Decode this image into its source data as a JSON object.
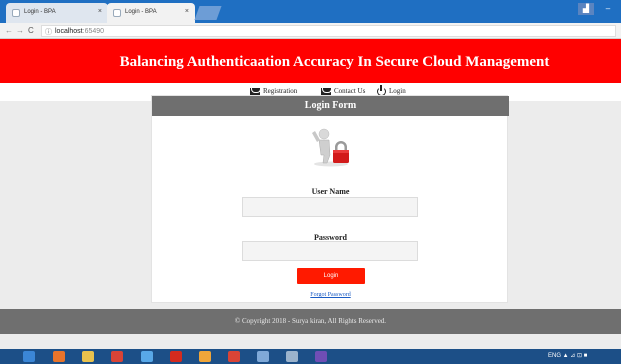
{
  "browser": {
    "tabs": [
      {
        "label": "Login - BPA"
      },
      {
        "label": "Login - BPA"
      }
    ],
    "close_glyph": "×",
    "address": {
      "host": "localhost",
      "port": ":65490",
      "info_glyph": "ⓘ"
    },
    "nav": {
      "back": "←",
      "forward": "→",
      "reload": "C"
    },
    "window": {
      "user_glyph": "▟",
      "minimize": "–"
    }
  },
  "header": {
    "title": "Balancing Authenticaation Accuracy In Secure Cloud Management"
  },
  "menu": {
    "items": [
      {
        "label": "Registration",
        "icon": "envelope-icon"
      },
      {
        "label": "Contact Us",
        "icon": "envelope-icon"
      },
      {
        "label": "Login",
        "icon": "power-icon"
      }
    ]
  },
  "login_form": {
    "heading": "Login Form",
    "image": "padlock-person-icon",
    "username_label": "User Name",
    "username_value": "",
    "password_label": "Password",
    "password_value": "",
    "submit_label": "Login",
    "forgot_label": "Forgot Password"
  },
  "footer": {
    "text": "© Copyright 2018 - Surya kiran, All Rights Reserved."
  },
  "taskbar": {
    "apps": [
      "chrome-icon",
      "windows-media-icon",
      "file-explorer-icon",
      "chrome-icon",
      "internet-explorer-icon",
      "acrobat-icon",
      "paint-icon",
      "chrome-icon",
      "notes-icon",
      "vlc-icon",
      "visual-studio-icon"
    ],
    "tray_text": "ENG ▲ ⊿ ⊡ ■"
  },
  "colors": {
    "accent_red": "#ff0000",
    "panel_gray": "#6f6f6f",
    "tab_blue": "#1f6fc2",
    "taskbar_blue": "#1c4f87",
    "link_blue": "#1a5bc4"
  }
}
